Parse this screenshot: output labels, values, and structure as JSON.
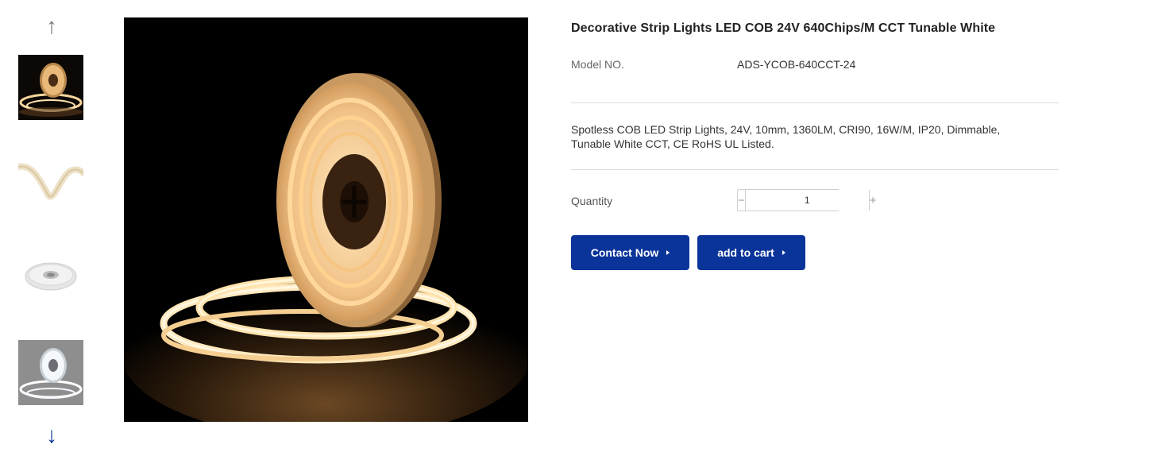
{
  "gallery": {
    "up_icon": "arrow-up-icon",
    "down_icon": "arrow-down-icon",
    "up_glyph": "↑",
    "down_glyph": "↓",
    "thumbnails": [
      "led-reel-warm",
      "led-strip-twist",
      "led-reel-white",
      "led-reel-cool-gray"
    ]
  },
  "product": {
    "title": "Decorative Strip Lights LED COB 24V 640Chips/M CCT Tunable White",
    "model_label": "Model NO.",
    "model_value": "ADS-YCOB-640CCT-24",
    "description": "Spotless COB LED Strip Lights, 24V, 10mm, 1360LM, CRI90, 16W/M, IP20, Dimmable, Tunable White CCT, CE RoHS UL Listed."
  },
  "quantity": {
    "label": "Quantity",
    "value": "1",
    "minus": "−",
    "plus": "+"
  },
  "actions": {
    "contact_label": "Contact Now",
    "cart_label": "add to cart"
  },
  "colors": {
    "accent": "#0a3499",
    "divider": "#dcdcdc"
  }
}
